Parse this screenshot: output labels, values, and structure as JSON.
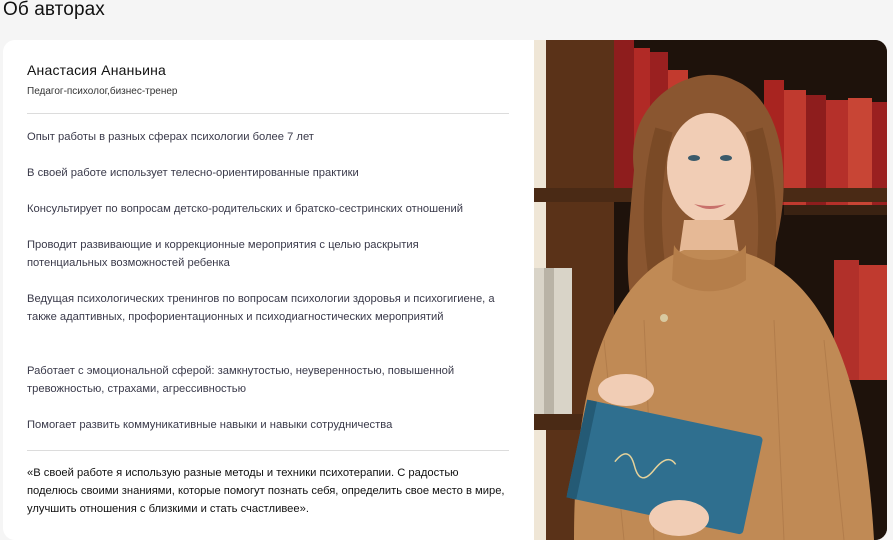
{
  "section": {
    "title": "Об авторах"
  },
  "author": {
    "name": "Анастасия Ананьина",
    "role": "Педагог-психолог,бизнес-тренер",
    "facts": [
      "Опыт работы в разных сферах психологии более 7 лет",
      "В своей работе использует телесно-ориентированные практики",
      "Консультирует по вопросам детско-родительских и братско-сестринских отношений",
      "Проводит развивающие и коррекционные мероприятия с целью раскрытия потенциальных возможностей ребенка",
      "Ведущая психологических тренингов по вопросам психологии здоровья и психогигиене, а также адаптивных, профориентационных и психодиагностических мероприятий",
      "Работает с эмоциональной сферой: замкнутостью, неуверенностью, повышенной тревожностью, страхами, агрессивностью",
      "Помогает развить коммуникативные навыки и навыки сотрудничества"
    ],
    "quote": "«В своей работе я использую разные методы и техники психотерапии. С радостью поделюсь своими знаниями, которые помогут познать себя, определить свое место в мире, улучшить отношения с близкими и стать счастливее».",
    "photo_icon": "author-portrait"
  },
  "colors": {
    "page_bg": "#f5f5f5",
    "card_bg": "#ffffff",
    "text": "#3a3a4a",
    "divider": "#dcdcdc",
    "sweater": "#c08a55",
    "book": "#2f6f8f",
    "hair": "#8a5630",
    "shelf": "#5a3218"
  }
}
